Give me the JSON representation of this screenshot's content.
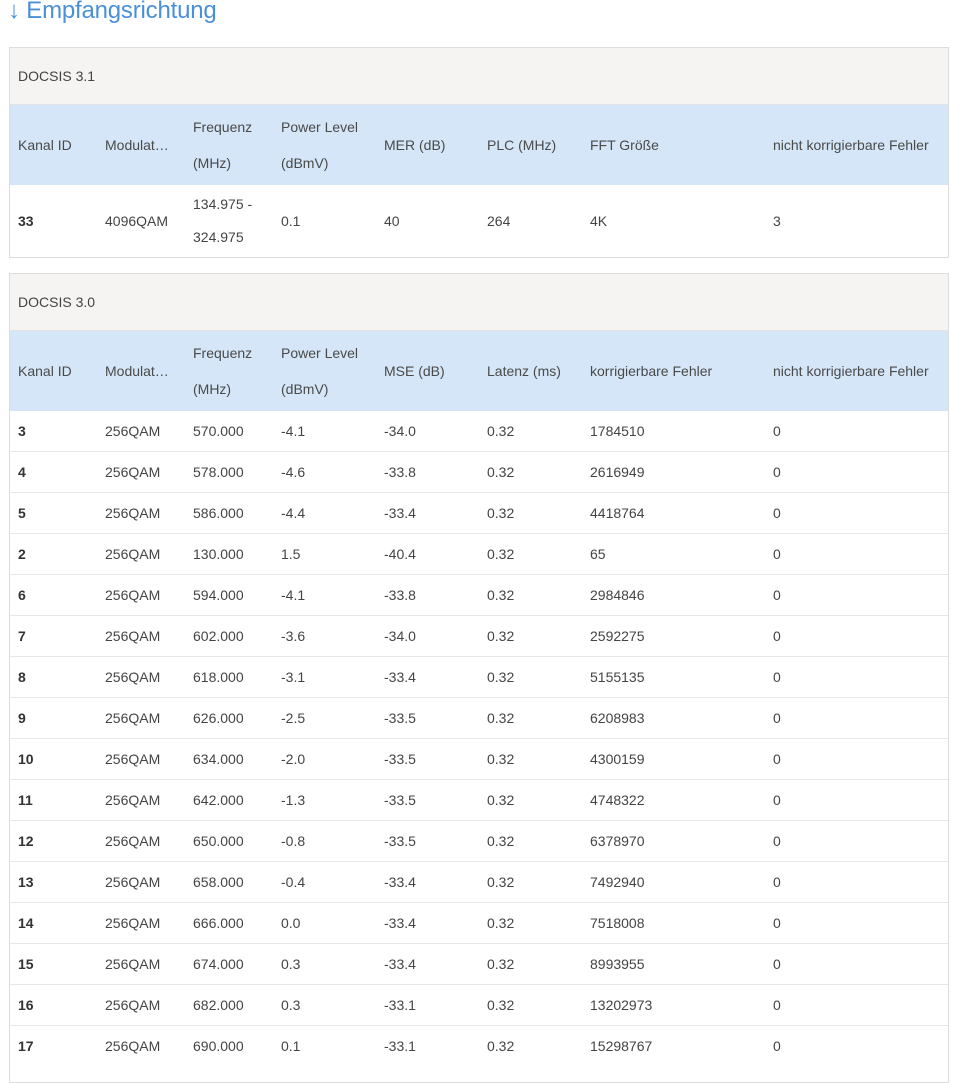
{
  "title": "↓ Empfangsrichtung",
  "docsis31": {
    "heading": "DOCSIS 3.1",
    "headers": [
      "Kanal ID",
      "Modulat…",
      "Frequenz (MHz)",
      "Power Level (dBmV)",
      "MER (dB)",
      "PLC (MHz)",
      "FFT Größe",
      "nicht korrigierbare Fehler"
    ],
    "rows": [
      [
        "33",
        "4096QAM",
        "134.975 - 324.975",
        "0.1",
        "40",
        "264",
        "4K",
        "3"
      ]
    ]
  },
  "docsis30": {
    "heading": "DOCSIS 3.0",
    "headers": [
      "Kanal ID",
      "Modulat…",
      "Frequenz (MHz)",
      "Power Level (dBmV)",
      "MSE (dB)",
      "Latenz (ms)",
      "korrigierbare Fehler",
      "nicht korrigierbare Fehler"
    ],
    "rows": [
      [
        "3",
        "256QAM",
        "570.000",
        "-4.1",
        "-34.0",
        "0.32",
        "1784510",
        "0"
      ],
      [
        "4",
        "256QAM",
        "578.000",
        "-4.6",
        "-33.8",
        "0.32",
        "2616949",
        "0"
      ],
      [
        "5",
        "256QAM",
        "586.000",
        "-4.4",
        "-33.4",
        "0.32",
        "4418764",
        "0"
      ],
      [
        "2",
        "256QAM",
        "130.000",
        "1.5",
        "-40.4",
        "0.32",
        "65",
        "0"
      ],
      [
        "6",
        "256QAM",
        "594.000",
        "-4.1",
        "-33.8",
        "0.32",
        "2984846",
        "0"
      ],
      [
        "7",
        "256QAM",
        "602.000",
        "-3.6",
        "-34.0",
        "0.32",
        "2592275",
        "0"
      ],
      [
        "8",
        "256QAM",
        "618.000",
        "-3.1",
        "-33.4",
        "0.32",
        "5155135",
        "0"
      ],
      [
        "9",
        "256QAM",
        "626.000",
        "-2.5",
        "-33.5",
        "0.32",
        "6208983",
        "0"
      ],
      [
        "10",
        "256QAM",
        "634.000",
        "-2.0",
        "-33.5",
        "0.32",
        "4300159",
        "0"
      ],
      [
        "11",
        "256QAM",
        "642.000",
        "-1.3",
        "-33.5",
        "0.32",
        "4748322",
        "0"
      ],
      [
        "12",
        "256QAM",
        "650.000",
        "-0.8",
        "-33.5",
        "0.32",
        "6378970",
        "0"
      ],
      [
        "13",
        "256QAM",
        "658.000",
        "-0.4",
        "-33.4",
        "0.32",
        "7492940",
        "0"
      ],
      [
        "14",
        "256QAM",
        "666.000",
        "0.0",
        "-33.4",
        "0.32",
        "7518008",
        "0"
      ],
      [
        "15",
        "256QAM",
        "674.000",
        "0.3",
        "-33.4",
        "0.32",
        "8993955",
        "0"
      ],
      [
        "16",
        "256QAM",
        "682.000",
        "0.3",
        "-33.1",
        "0.32",
        "13202973",
        "0"
      ],
      [
        "17",
        "256QAM",
        "690.000",
        "0.1",
        "-33.1",
        "0.32",
        "15298767",
        "0"
      ]
    ]
  }
}
